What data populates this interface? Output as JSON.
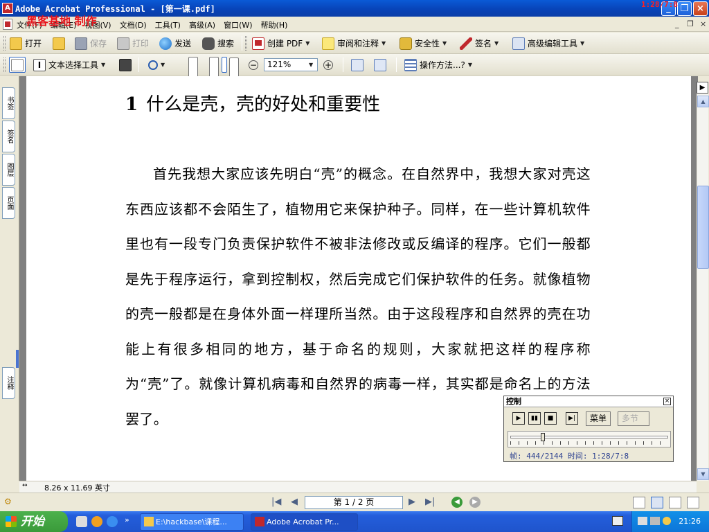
{
  "window": {
    "title": "Adobe Acrobat Professional - [第一课.pdf]",
    "watermark": "黑客基地 制作",
    "recording_time": "1:28/7:8"
  },
  "menu": {
    "items": [
      "文件(F)",
      "编辑(E)",
      "视图(V)",
      "文档(D)",
      "工具(T)",
      "高级(A)",
      "窗口(W)",
      "帮助(H)"
    ]
  },
  "toolbar1": {
    "open": "打开",
    "save": "保存",
    "print": "打印",
    "send": "发送",
    "search": "搜索",
    "create_pdf": "创建 PDF",
    "review": "审阅和注释",
    "security": "安全性",
    "sign": "签名",
    "advanced_edit": "高级编辑工具"
  },
  "toolbar2": {
    "text_select": "文本选择工具",
    "zoom_value": "121%",
    "how_to": "操作方法...?"
  },
  "nav_tabs": [
    "书签",
    "签名",
    "图层",
    "页面",
    "注释"
  ],
  "document": {
    "heading_num": "1",
    "heading_text": "什么是壳，壳的好处和重要性",
    "paragraph": "首先我想大家应该先明白“壳”的概念。在自然界中，我想大家对壳这东西应该都不会陌生了，植物用它来保护种子。同样，在一些计算机软件里也有一段专门负责保护软件不被非法修改或反编译的程序。它们一般都是先于程序运行，拿到控制权，然后完成它们保护软件的任务。就像植物的壳一般都是在身体外面一样理所当然。由于这段程序和自然界的壳在功能上有很多相同的地方，基于命名的规则，大家就把这样的程序称为“壳”了。就像计算机病毒和自然界的病毒一样，其实都是命名上的方法罢了。"
  },
  "bottom": {
    "page_size": "8.26 x 11.69 英寸",
    "page_indicator": "第 1 / 2 页"
  },
  "control_panel": {
    "title": "控制",
    "menu_btn": "菜单",
    "multi_btn": "多节",
    "progress": 0.207,
    "info": "帧: 444/2144 时间: 1:28/7:8"
  },
  "taskbar": {
    "start": "开始",
    "task1": "E:\\hackbase\\课程...",
    "task2": "Adobe Acrobat Pr...",
    "clock": "21:26"
  },
  "colors": {
    "titlebar": "#0a5ad6",
    "watermark": "#e8141c",
    "taskbar": "#245edb",
    "start": "#3a9a3a"
  }
}
